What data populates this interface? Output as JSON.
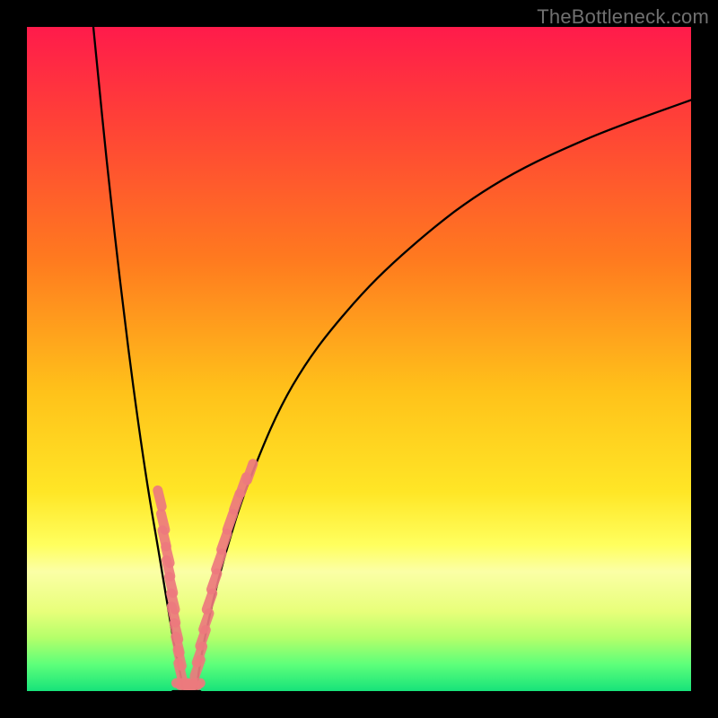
{
  "watermark": {
    "text": "TheBottleneck.com"
  },
  "colors": {
    "frame": "#000000",
    "curve": "#000000",
    "dots": "#ed7a7e",
    "gradient_stops": [
      {
        "offset": 0.0,
        "color": "#ff1b4b"
      },
      {
        "offset": 0.15,
        "color": "#ff4336"
      },
      {
        "offset": 0.35,
        "color": "#ff7a1f"
      },
      {
        "offset": 0.55,
        "color": "#ffc21a"
      },
      {
        "offset": 0.7,
        "color": "#ffe626"
      },
      {
        "offset": 0.78,
        "color": "#ffff5e"
      },
      {
        "offset": 0.82,
        "color": "#fbffa6"
      },
      {
        "offset": 0.88,
        "color": "#e8ff7a"
      },
      {
        "offset": 0.92,
        "color": "#b4ff6a"
      },
      {
        "offset": 0.96,
        "color": "#5dff7a"
      },
      {
        "offset": 1.0,
        "color": "#17e37a"
      }
    ]
  },
  "chart_data": {
    "type": "line",
    "title": "",
    "xlabel": "",
    "ylabel": "",
    "xlim": [
      0,
      100
    ],
    "ylim": [
      0,
      100
    ],
    "notched_min": {
      "x_center": 24,
      "flat_halfwidth": 2,
      "y": 0
    },
    "series": [
      {
        "name": "left-arm",
        "x": [
          10.0,
          12.0,
          14.0,
          16.0,
          18.0,
          20.0,
          22.0,
          23.5
        ],
        "values": [
          100.0,
          80.0,
          62.0,
          46.0,
          32.0,
          20.0,
          8.0,
          0.0
        ]
      },
      {
        "name": "right-arm",
        "x": [
          25.5,
          27.0,
          30.0,
          34.0,
          40.0,
          48.0,
          58.0,
          70.0,
          84.0,
          100.0
        ],
        "values": [
          0.0,
          9.0,
          21.0,
          33.0,
          46.0,
          57.0,
          67.0,
          76.0,
          83.0,
          89.0
        ]
      }
    ],
    "scatter_clusters": [
      {
        "name": "left-arm-dots",
        "points": [
          {
            "x": 20.0,
            "y": 29.0
          },
          {
            "x": 20.5,
            "y": 25.5
          },
          {
            "x": 20.7,
            "y": 23.0
          },
          {
            "x": 21.2,
            "y": 20.5
          },
          {
            "x": 21.3,
            "y": 18.5
          },
          {
            "x": 21.7,
            "y": 16.0
          },
          {
            "x": 22.0,
            "y": 13.5
          },
          {
            "x": 22.1,
            "y": 11.5
          },
          {
            "x": 22.5,
            "y": 9.0
          },
          {
            "x": 22.7,
            "y": 7.0
          },
          {
            "x": 23.0,
            "y": 5.0
          },
          {
            "x": 23.1,
            "y": 3.0
          }
        ]
      },
      {
        "name": "bottom-dots",
        "points": [
          {
            "x": 23.3,
            "y": 1.2
          },
          {
            "x": 23.9,
            "y": 0.9
          },
          {
            "x": 24.4,
            "y": 0.9
          },
          {
            "x": 24.9,
            "y": 0.9
          },
          {
            "x": 25.3,
            "y": 1.2
          }
        ]
      },
      {
        "name": "right-arm-dots",
        "points": [
          {
            "x": 25.7,
            "y": 3.5
          },
          {
            "x": 26.0,
            "y": 5.5
          },
          {
            "x": 26.5,
            "y": 8.0
          },
          {
            "x": 27.0,
            "y": 10.5
          },
          {
            "x": 27.5,
            "y": 13.5
          },
          {
            "x": 28.2,
            "y": 16.5
          },
          {
            "x": 28.9,
            "y": 19.5
          },
          {
            "x": 29.7,
            "y": 22.5
          },
          {
            "x": 30.6,
            "y": 25.5
          },
          {
            "x": 31.6,
            "y": 28.5
          },
          {
            "x": 32.6,
            "y": 31.0
          },
          {
            "x": 33.6,
            "y": 33.0
          }
        ]
      }
    ]
  }
}
